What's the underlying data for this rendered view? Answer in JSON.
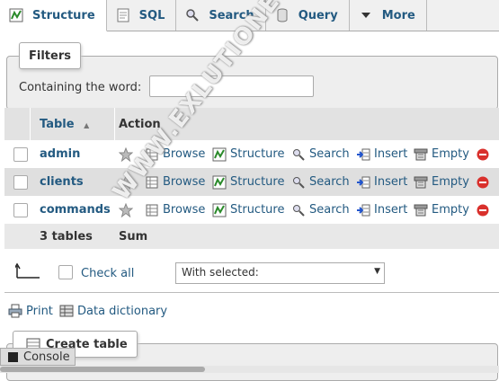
{
  "tabs": [
    {
      "label": "Structure",
      "icon": "structure-icon",
      "active": true
    },
    {
      "label": "SQL",
      "icon": "sql-icon"
    },
    {
      "label": "Search",
      "icon": "search-icon"
    },
    {
      "label": "Query",
      "icon": "query-icon"
    },
    {
      "label": "More",
      "icon": "chevron-down-icon"
    }
  ],
  "filters": {
    "legend": "Filters",
    "label": "Containing the word:",
    "value": ""
  },
  "table": {
    "headers": {
      "table": "Table",
      "action": "Action"
    },
    "rows": [
      {
        "name": "admin"
      },
      {
        "name": "clients"
      },
      {
        "name": "commands"
      }
    ],
    "actions": [
      "Browse",
      "Structure",
      "Search",
      "Insert",
      "Empty"
    ],
    "summary": {
      "count": "3 tables",
      "sum": "Sum"
    }
  },
  "bulk": {
    "check_all": "Check all",
    "with_selected": "With selected:"
  },
  "links": {
    "print": "Print",
    "data_dictionary": "Data dictionary"
  },
  "create_table": "Create table",
  "console": "Console",
  "watermark": "WWW.EXLUTIONE.COM",
  "colors": {
    "link": "#235a81",
    "header_bg": "#e2e2e2",
    "stripe": "#dfdfdf",
    "drop": "#d9302c"
  }
}
